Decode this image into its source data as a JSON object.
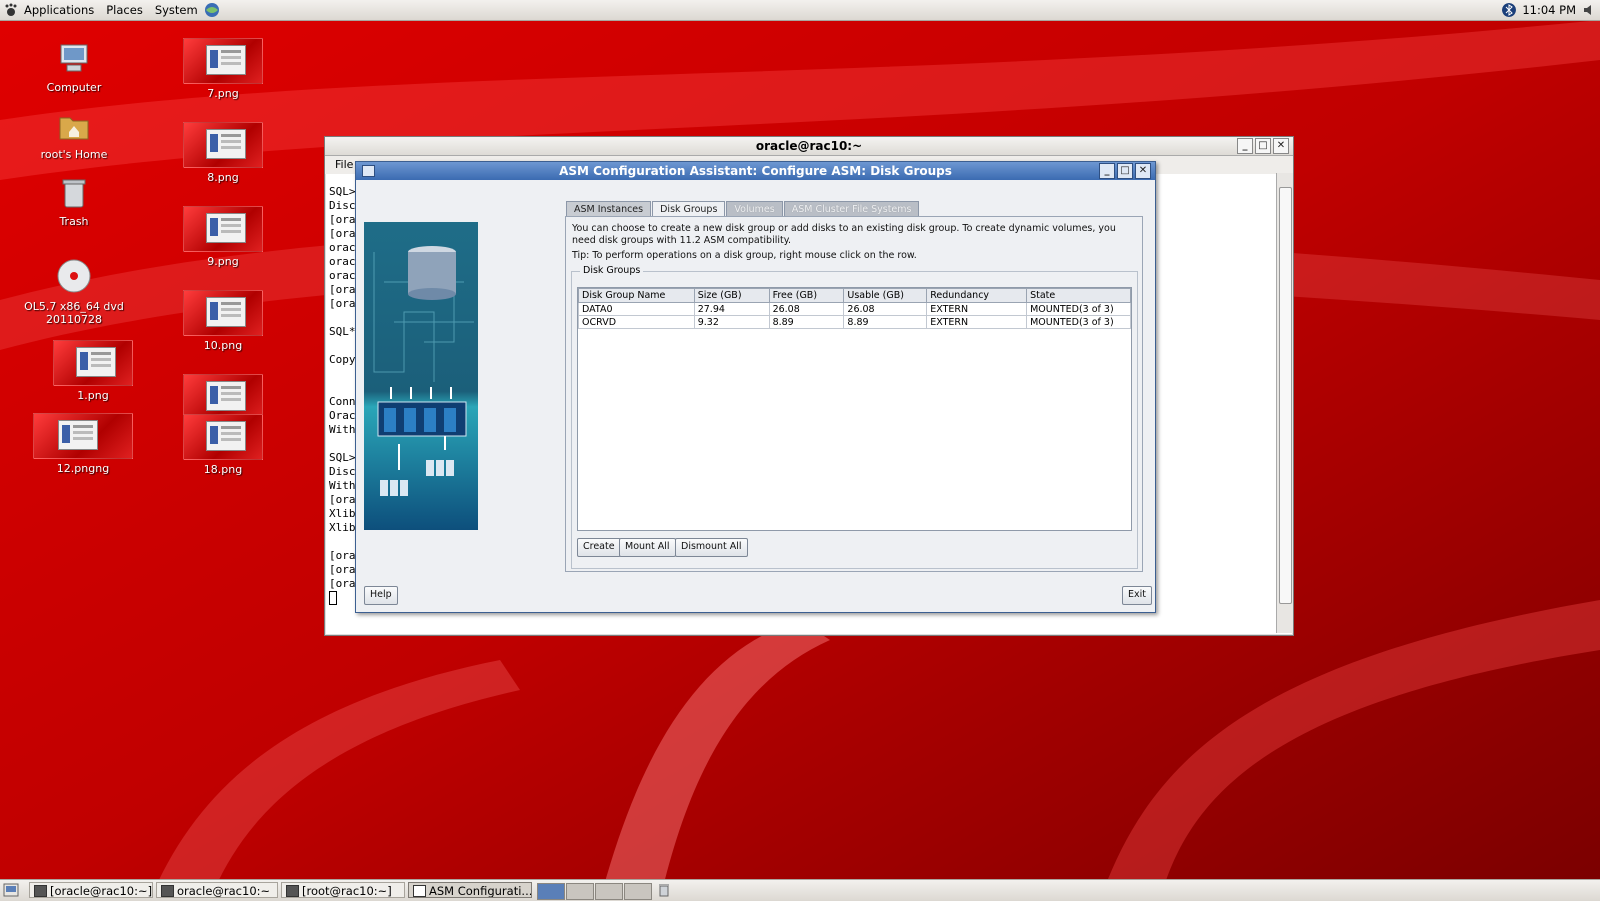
{
  "top_panel": {
    "menus": [
      "Applications",
      "Places",
      "System"
    ],
    "clock": "11:04 PM"
  },
  "desktop": {
    "icons": [
      {
        "label": "Computer"
      },
      {
        "label": "root's Home"
      },
      {
        "label": "Trash"
      },
      {
        "label": "OL5.7 x86_64 dvd 20110728"
      },
      {
        "label": "1.png"
      },
      {
        "label": "12.pngng"
      },
      {
        "label": "7.png"
      },
      {
        "label": "8.png"
      },
      {
        "label": "9.png"
      },
      {
        "label": "10.png"
      },
      {
        "label": "18.png"
      }
    ]
  },
  "terminal": {
    "title": "oracle@rac10:~",
    "menu_file": "File",
    "lines": [
      "SQL>",
      "Disc",
      "[ora",
      "[ora",
      "orac",
      "orac",
      "orac",
      "[ora",
      "[ora",
      "SQL*",
      "Copy",
      "Conn",
      "Orac",
      "With",
      "SQL>",
      "Disc",
      "With",
      "[ora",
      "Xlib",
      "Xlib",
      "[ora",
      "[ora",
      "[oracle@rac10 ~]$ asmca"
    ]
  },
  "asm": {
    "title": "ASM Configuration Assistant: Configure ASM: Disk Groups",
    "tabs": [
      "ASM Instances",
      "Disk Groups",
      "Volumes",
      "ASM Cluster File Systems"
    ],
    "intro": "You can choose to create a new disk group or add disks to an existing disk group. To create dynamic volumes, you need disk groups with 11.2 ASM compatibility.",
    "tip": "Tip: To perform operations on a disk group, right mouse click on the row.",
    "group_label": "Disk Groups",
    "table": {
      "headers": [
        "Disk Group Name",
        "Size (GB)",
        "Free (GB)",
        "Usable (GB)",
        "Redundancy",
        "State"
      ],
      "rows": [
        [
          "DATA0",
          "27.94",
          "26.08",
          "26.08",
          "EXTERN",
          "MOUNTED(3 of 3)"
        ],
        [
          "OCRVD",
          "9.32",
          "8.89",
          "8.89",
          "EXTERN",
          "MOUNTED(3 of 3)"
        ]
      ]
    },
    "buttons": {
      "create": "Create",
      "mount_all": "Mount All",
      "dismount_all": "Dismount All",
      "help": "Help",
      "exit": "Exit"
    }
  },
  "taskbar": {
    "tasks": [
      "[oracle@rac10:~]",
      "oracle@rac10:~",
      "[root@rac10:~]",
      "ASM Configurati..."
    ]
  }
}
